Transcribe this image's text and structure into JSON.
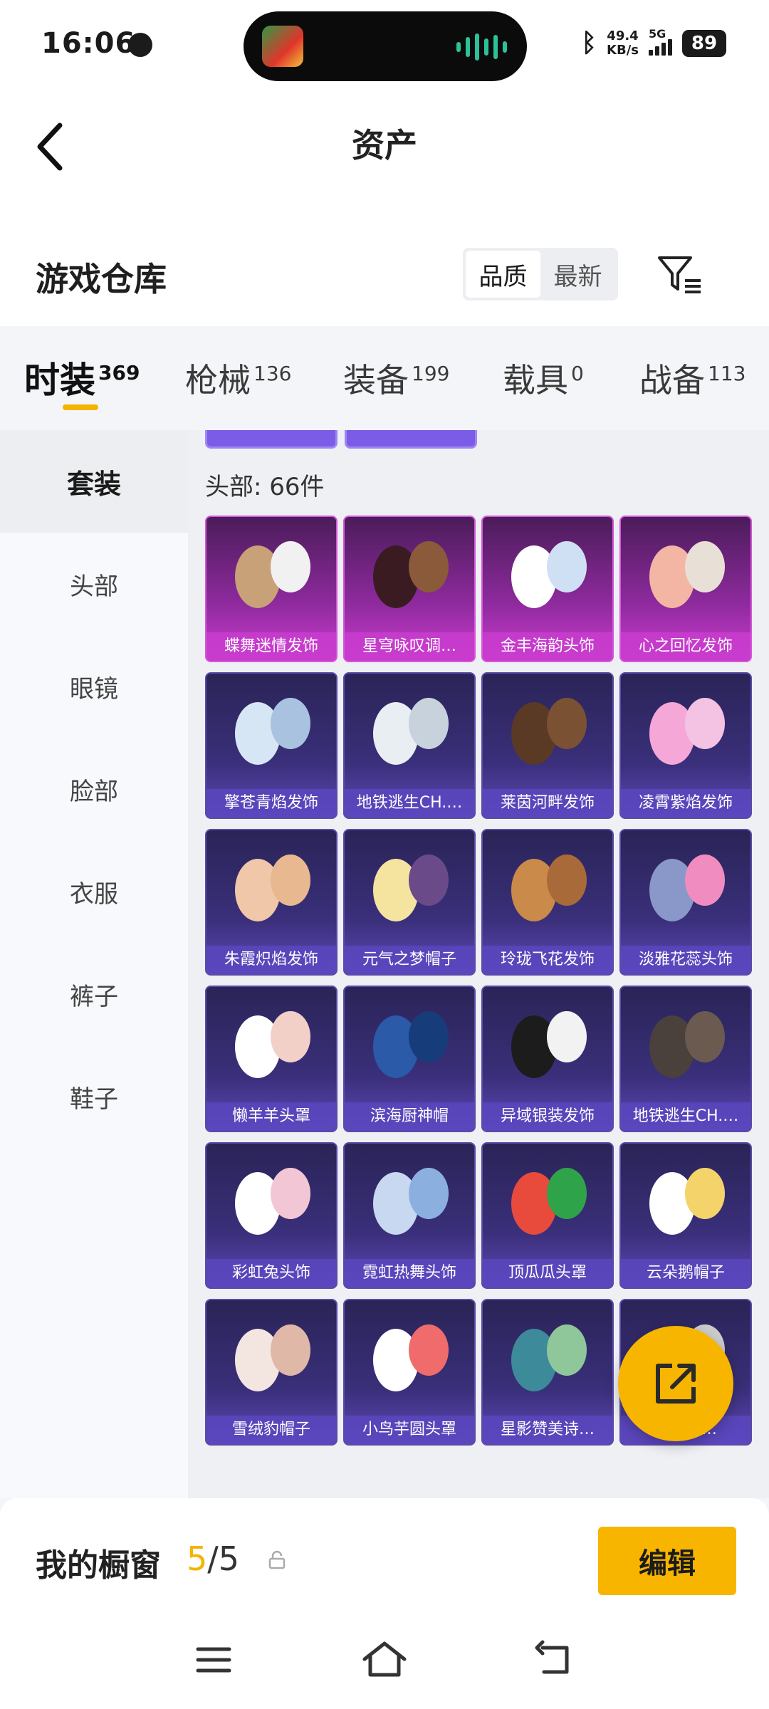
{
  "status_bar": {
    "time": "16:06",
    "net_speed_value": "49.4",
    "net_speed_unit": "KB/s",
    "network": "5G",
    "battery": "89"
  },
  "header": {
    "title": "资产"
  },
  "warehouse": {
    "title": "游戏仓库",
    "sort_options": [
      "品质",
      "最新"
    ],
    "sort_selected": "品质"
  },
  "tabs": [
    {
      "label": "时装",
      "count": "369"
    },
    {
      "label": "枪械",
      "count": "136"
    },
    {
      "label": "装备",
      "count": "199"
    },
    {
      "label": "载具",
      "count": "0"
    },
    {
      "label": "战备",
      "count": "113"
    }
  ],
  "sidebar": {
    "items": [
      "套装",
      "头部",
      "眼镜",
      "脸部",
      "衣服",
      "裤子",
      "鞋子"
    ]
  },
  "content": {
    "count_label": "头部: 66件",
    "items": [
      {
        "name": "蝶舞迷情发饰",
        "tier": "legendary"
      },
      {
        "name": "星穹咏叹调…",
        "tier": "legendary"
      },
      {
        "name": "金丰海韵头饰",
        "tier": "legendary"
      },
      {
        "name": "心之回忆发饰",
        "tier": "legendary"
      },
      {
        "name": "擎苍青焰发饰",
        "tier": "epic"
      },
      {
        "name": "地铁逃生CH.…",
        "tier": "epic"
      },
      {
        "name": "莱茵河畔发饰",
        "tier": "epic"
      },
      {
        "name": "凌霄紫焰发饰",
        "tier": "epic"
      },
      {
        "name": "朱霞炽焰发饰",
        "tier": "epic"
      },
      {
        "name": "元气之梦帽子",
        "tier": "epic"
      },
      {
        "name": "玲珑飞花发饰",
        "tier": "epic"
      },
      {
        "name": "淡雅花蕊头饰",
        "tier": "epic"
      },
      {
        "name": "懒羊羊头罩",
        "tier": "epic"
      },
      {
        "name": "滨海厨神帽",
        "tier": "epic"
      },
      {
        "name": "异域银装发饰",
        "tier": "epic"
      },
      {
        "name": "地铁逃生CH.…",
        "tier": "epic"
      },
      {
        "name": "彩虹兔头饰",
        "tier": "epic"
      },
      {
        "name": "霓虹热舞头饰",
        "tier": "epic"
      },
      {
        "name": "顶瓜瓜头罩",
        "tier": "epic"
      },
      {
        "name": "云朵鹅帽子",
        "tier": "epic"
      },
      {
        "name": "雪绒豹帽子",
        "tier": "epic"
      },
      {
        "name": "小鸟芋圆头罩",
        "tier": "epic"
      },
      {
        "name": "星影赞美诗…",
        "tier": "epic"
      },
      {
        "name": "星…曲…",
        "tier": "epic"
      }
    ]
  },
  "showcase": {
    "label": "我的橱窗",
    "current": "5",
    "total": "/5",
    "edit_label": "编辑"
  },
  "colors": {
    "accent": "#f7b500",
    "epic": "#3a2f7a",
    "legendary": "#8e2a9d"
  }
}
